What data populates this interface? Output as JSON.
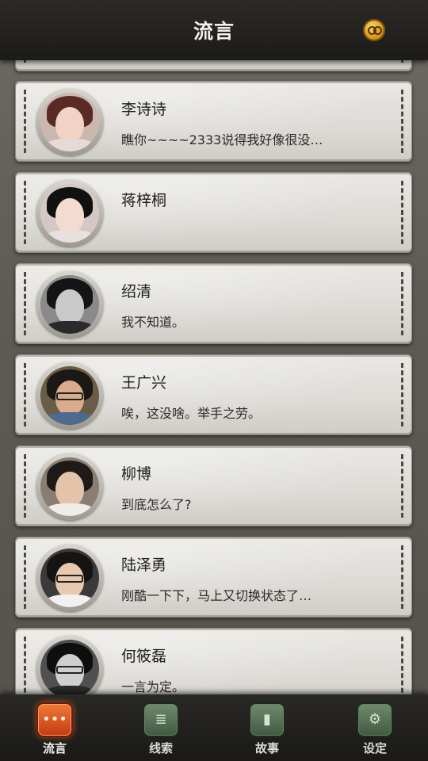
{
  "header": {
    "title": "流言",
    "currency_icon": "coin-icon"
  },
  "contacts": [
    {
      "name": "李诗诗",
      "preview": "瞧你~~~~2333说得我好像很没…",
      "skin": "#f1d2c4",
      "hair": "#5a2b24",
      "cloth": "#e7d9d6",
      "bg": "#cbb7b0",
      "glasses": false
    },
    {
      "name": "蒋梓桐",
      "preview": "",
      "skin": "#f3dccf",
      "hair": "#111111",
      "cloth": "#e9dfdc",
      "bg": "#d4c8c4",
      "glasses": false
    },
    {
      "name": "绍清",
      "preview": "我不知道。",
      "skin": "#c9c9c9",
      "hair": "#141414",
      "cloth": "#2a2a2a",
      "bg": "#8a8a8a",
      "glasses": false
    },
    {
      "name": "王广兴",
      "preview": "唉，这没啥。举手之劳。",
      "skin": "#d9ac8e",
      "hair": "#1b1816",
      "cloth": "#4d6b8f",
      "bg": "#6a5c46",
      "glasses": true
    },
    {
      "name": "柳博",
      "preview": "到底怎么了?",
      "skin": "#e4c3ab",
      "hair": "#1d1a18",
      "cloth": "#f0ece8",
      "bg": "#8a7d72",
      "glasses": false
    },
    {
      "name": "陆泽勇",
      "preview": "刚酷一下下，马上又切换状态了…",
      "skin": "#e8c9b0",
      "hair": "#161412",
      "cloth": "#f1f1f1",
      "bg": "#3a3a3a",
      "glasses": true
    },
    {
      "name": "何筱磊",
      "preview": "一言为定。",
      "skin": "#cfcfcf",
      "hair": "#0e0e0e",
      "cloth": "#2a2a2a",
      "bg": "#505050",
      "glasses": true
    }
  ],
  "nav": [
    {
      "label": "流言",
      "icon": "chat-bubble-icon",
      "glyph": "•••",
      "active": true
    },
    {
      "label": "线索",
      "icon": "document-icon",
      "glyph": "≣",
      "active": false
    },
    {
      "label": "故事",
      "icon": "book-icon",
      "glyph": "▮",
      "active": false
    },
    {
      "label": "设定",
      "icon": "gear-icon",
      "glyph": "⚙",
      "active": false
    }
  ]
}
